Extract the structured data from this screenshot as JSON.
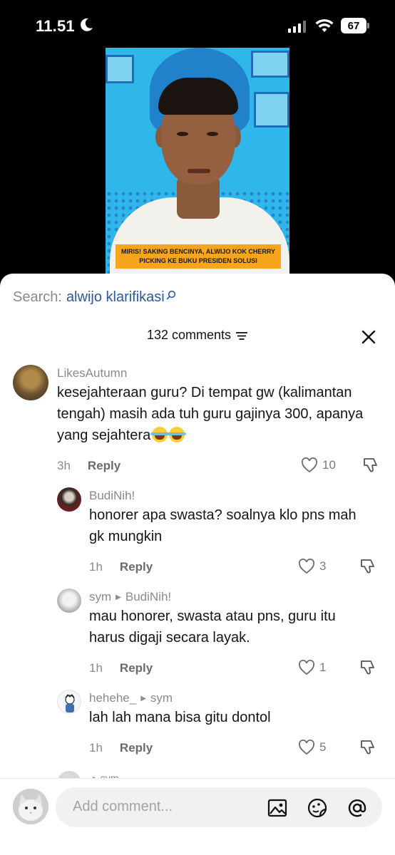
{
  "status_bar": {
    "time": "11.51",
    "battery": "67"
  },
  "video": {
    "caption_line1": "MIRIS! SAKING BENCINYA, ALWIJO KOK CHERRY",
    "caption_line2": "PICKING KE BUKU PRESIDEN SOLUSI"
  },
  "search": {
    "label": "Search:",
    "term": "alwijo klarifikasi"
  },
  "comments_header": {
    "title": "132 comments"
  },
  "comments": [
    {
      "username": "LikesAutumn",
      "text": "kesejahteraan guru? Di tempat gw (kalimantan tengah) masih ada tuh guru gajinya 300, apanya yang sejahtera",
      "time": "3h",
      "reply_label": "Reply",
      "likes": "10"
    },
    {
      "username": "BudiNih!",
      "text": "honorer apa swasta? soalnya klo pns mah gk mungkin",
      "time": "1h",
      "reply_label": "Reply",
      "likes": "3"
    },
    {
      "username": "sym",
      "reply_to": "BudiNih!",
      "text": "mau honorer, swasta atau pns, guru itu harus digaji secara layak.",
      "time": "1h",
      "reply_label": "Reply",
      "likes": "1"
    },
    {
      "username": "hehehe_",
      "reply_to": "sym",
      "text": "lah lah mana bisa gitu dontol",
      "time": "1h",
      "reply_label": "Reply",
      "likes": "5"
    }
  ],
  "peek_comment": {
    "text": "▸ sym"
  },
  "composer": {
    "placeholder": "Add comment..."
  }
}
